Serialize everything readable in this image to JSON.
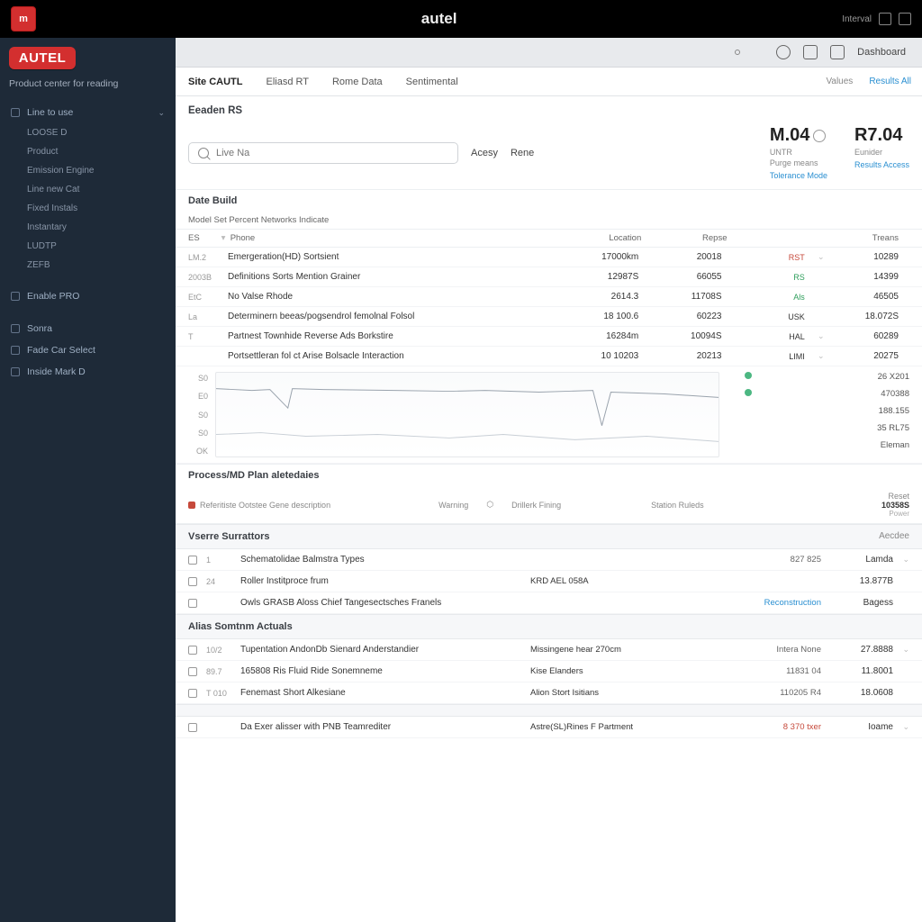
{
  "topbar": {
    "title": "autel",
    "right_label": "Interval",
    "account": "Dashboard"
  },
  "brand": "AUTEL",
  "tagline": "Product center for reading",
  "util": {
    "dashboard": "Dashboard"
  },
  "nav": {
    "group1": {
      "label": "Line to use",
      "sub": "LOOSE D"
    },
    "items1": [
      "Product",
      "Emission Engine",
      "Line new Cat",
      "Fixed Instals",
      "Instantary",
      "LUDTP",
      "ZEFB"
    ],
    "group2": "Enable PRO",
    "group3": "Sonra",
    "items3": [
      "Fade Car Select",
      "Inside Mark D"
    ]
  },
  "tabs": {
    "items": [
      "Site CAUTL",
      "Eliasd RT",
      "Rome Data",
      "Sentimental"
    ],
    "active": 0,
    "right": [
      {
        "t": "Values",
        "c": ""
      },
      {
        "t": "Results All",
        "c": "blue"
      }
    ]
  },
  "section1": "Eeaden RS",
  "search": {
    "placeholder": "Live Na",
    "filters": [
      "Acesy",
      "Rene"
    ]
  },
  "metrics": [
    {
      "value": "M.04",
      "unit": "UNTR",
      "sub": "Purge means",
      "link": "Tolerance Mode"
    },
    {
      "value": "R7.04",
      "unit": "",
      "sub": "Eunider",
      "link": "Results Access"
    }
  ],
  "table1": {
    "title": "Date Build",
    "header_note": "Model Set Percent Networks Indicate",
    "cols": [
      "ES",
      "Phone",
      "Location",
      "Repse",
      "",
      "Treans"
    ],
    "rows": [
      {
        "id": "LM.2",
        "name": "Emergeration(HD) Sortsient",
        "c2": "17000km",
        "c3": "20018",
        "c4": "RST",
        "c4c": "red",
        "c5": "10289",
        "chv": true
      },
      {
        "id": "2003B",
        "name": "Definitions Sorts Mention Grainer",
        "c2": "12987S",
        "c3": "66055",
        "c4": "RS",
        "c4c": "green",
        "c5": "14399",
        "chv": false
      },
      {
        "id": "EtC",
        "name": "No Valse Rhode",
        "c2": "2614.3",
        "c3": "11708S",
        "c4": "Als",
        "c4c": "green",
        "c5": "46505",
        "chv": false
      },
      {
        "id": "La",
        "name": "Determinern beeas/pogsendrol femolnal  Folsol",
        "c2": "18 100.6",
        "c3": "60223",
        "c4": "USK",
        "c4c": "",
        "c5": "18.072S",
        "chv": false
      },
      {
        "id": "T",
        "name": "Partnest Townhide Reverse Ads Borkstire",
        "c2": "16284m",
        "c3": "10094S",
        "c4": "HAL",
        "c4c": "",
        "c5": "60289",
        "chv": true
      },
      {
        "id": "",
        "name": "Portsettleran fol ct Arise Bolsacle Interaction",
        "c2": "10 10203",
        "c3": "20213",
        "c4": "LIMI",
        "c4c": "",
        "c5": "20275",
        "chv": true
      }
    ]
  },
  "chart": {
    "y": [
      "S0",
      "E0",
      "S0",
      "S0",
      "OK"
    ],
    "side": [
      {
        "l": "",
        "v": "26 X201",
        "d": true
      },
      {
        "l": "",
        "v": "470388",
        "d": true
      },
      {
        "l": "",
        "v": "188.155",
        "d": false
      },
      {
        "l": "",
        "v": "35 RL75",
        "d": false
      },
      {
        "l": "",
        "v": "Eleman",
        "d": false
      }
    ]
  },
  "legend": {
    "title": "Process/MD Plan aletedaies",
    "items": [
      "Referitiste Ootstee Gene description",
      "Warning",
      "Drillerk Fining",
      "Station Ruleds"
    ],
    "right": {
      "l": "Reset",
      "v": "10358S",
      "sub": "Power"
    }
  },
  "sect2": {
    "title": "Vserre Surrattors",
    "right": "Aecdee",
    "rows": [
      {
        "id": "1",
        "name": "Schematolidae Balmstra Types",
        "c2": "",
        "c3": "827 825",
        "c4": "Lamda",
        "chv": true
      },
      {
        "id": "24",
        "name": "Roller Institproce frum",
        "c2": "KRD AEL 058A",
        "c3": "",
        "c3c": "green",
        "c4": "13.877B",
        "chv": false
      },
      {
        "id": "",
        "name": "Owls GRASB Aloss Chief Tangesectsches  Franels",
        "c2": "",
        "c3": "Reconstruction",
        "c3c": "blue",
        "c4": "Bagess",
        "chv": false
      }
    ]
  },
  "sect3": {
    "title": "Alias Somtnm Actuals",
    "rows": [
      {
        "id": "10/2",
        "name": "Tupentation AndonDb Sienard Anderstandier",
        "c2": "Missingene hear 270cm",
        "c3": "Intera None",
        "c4": "27.8888",
        "chv": true
      },
      {
        "id": "89.7",
        "name": "165808 Ris Fluid Ride Sonemneme",
        "c2": "Kise Elanders",
        "c3": "11831 04",
        "c4": "11.8001",
        "chv": false
      },
      {
        "id": "T 010",
        "name": "Fenemast Short Alkesiane",
        "c2": "Alion Stort Isitians",
        "c3": "110205 R4",
        "c4": "18.0608",
        "chv": false
      }
    ]
  },
  "sect4": {
    "rows": [
      {
        "id": "",
        "name": "Da Exer alisser with PNB Teamrediter",
        "c2": "Astre(SL)Rines F Partment",
        "c3": "8 370 txer",
        "c3c": "red",
        "c4": "Ioame",
        "chv": true
      }
    ]
  }
}
